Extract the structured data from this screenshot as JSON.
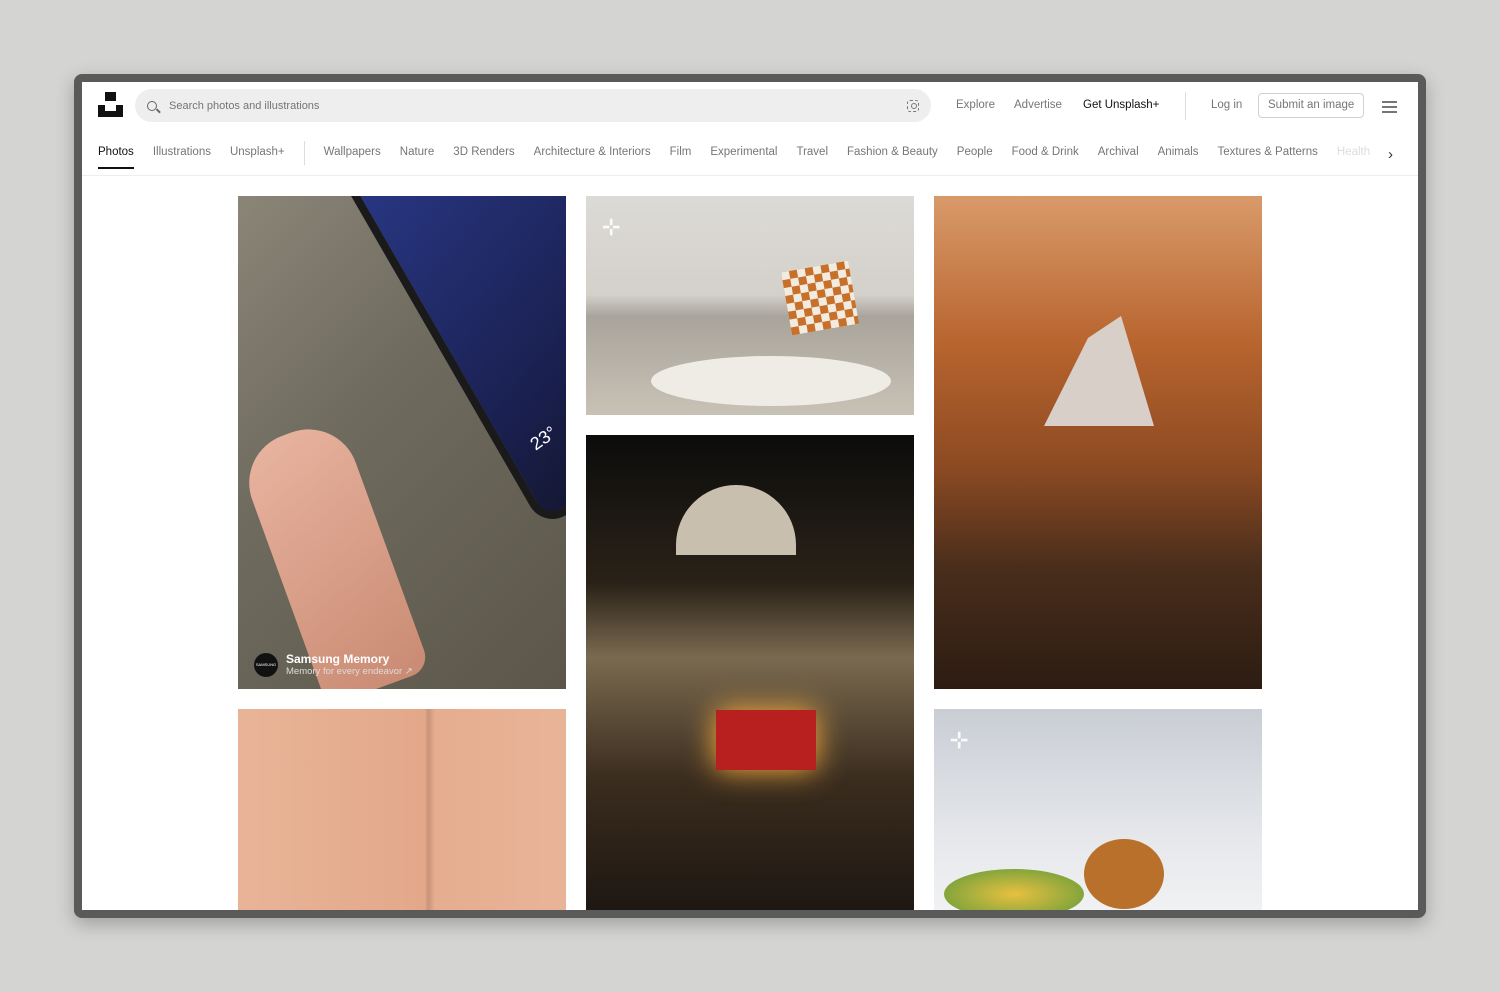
{
  "search": {
    "placeholder": "Search photos and illustrations"
  },
  "header": {
    "explore": "Explore",
    "advertise": "Advertise",
    "get_plus": "Get Unsplash+",
    "login": "Log in",
    "submit": "Submit an image"
  },
  "nav": {
    "items": [
      "Photos",
      "Illustrations",
      "Unsplash+",
      "Wallpapers",
      "Nature",
      "3D Renders",
      "Architecture & Interiors",
      "Film",
      "Experimental",
      "Travel",
      "Fashion & Beauty",
      "People",
      "Food & Drink",
      "Archival",
      "Animals",
      "Textures & Patterns",
      "Health"
    ],
    "active": "Photos"
  },
  "sponsor": {
    "name": "Samsung Memory",
    "tagline": "Memory for every endeavor ↗",
    "avatar": "SAMSUNG Memory"
  },
  "phone": {
    "temp": "23°"
  }
}
